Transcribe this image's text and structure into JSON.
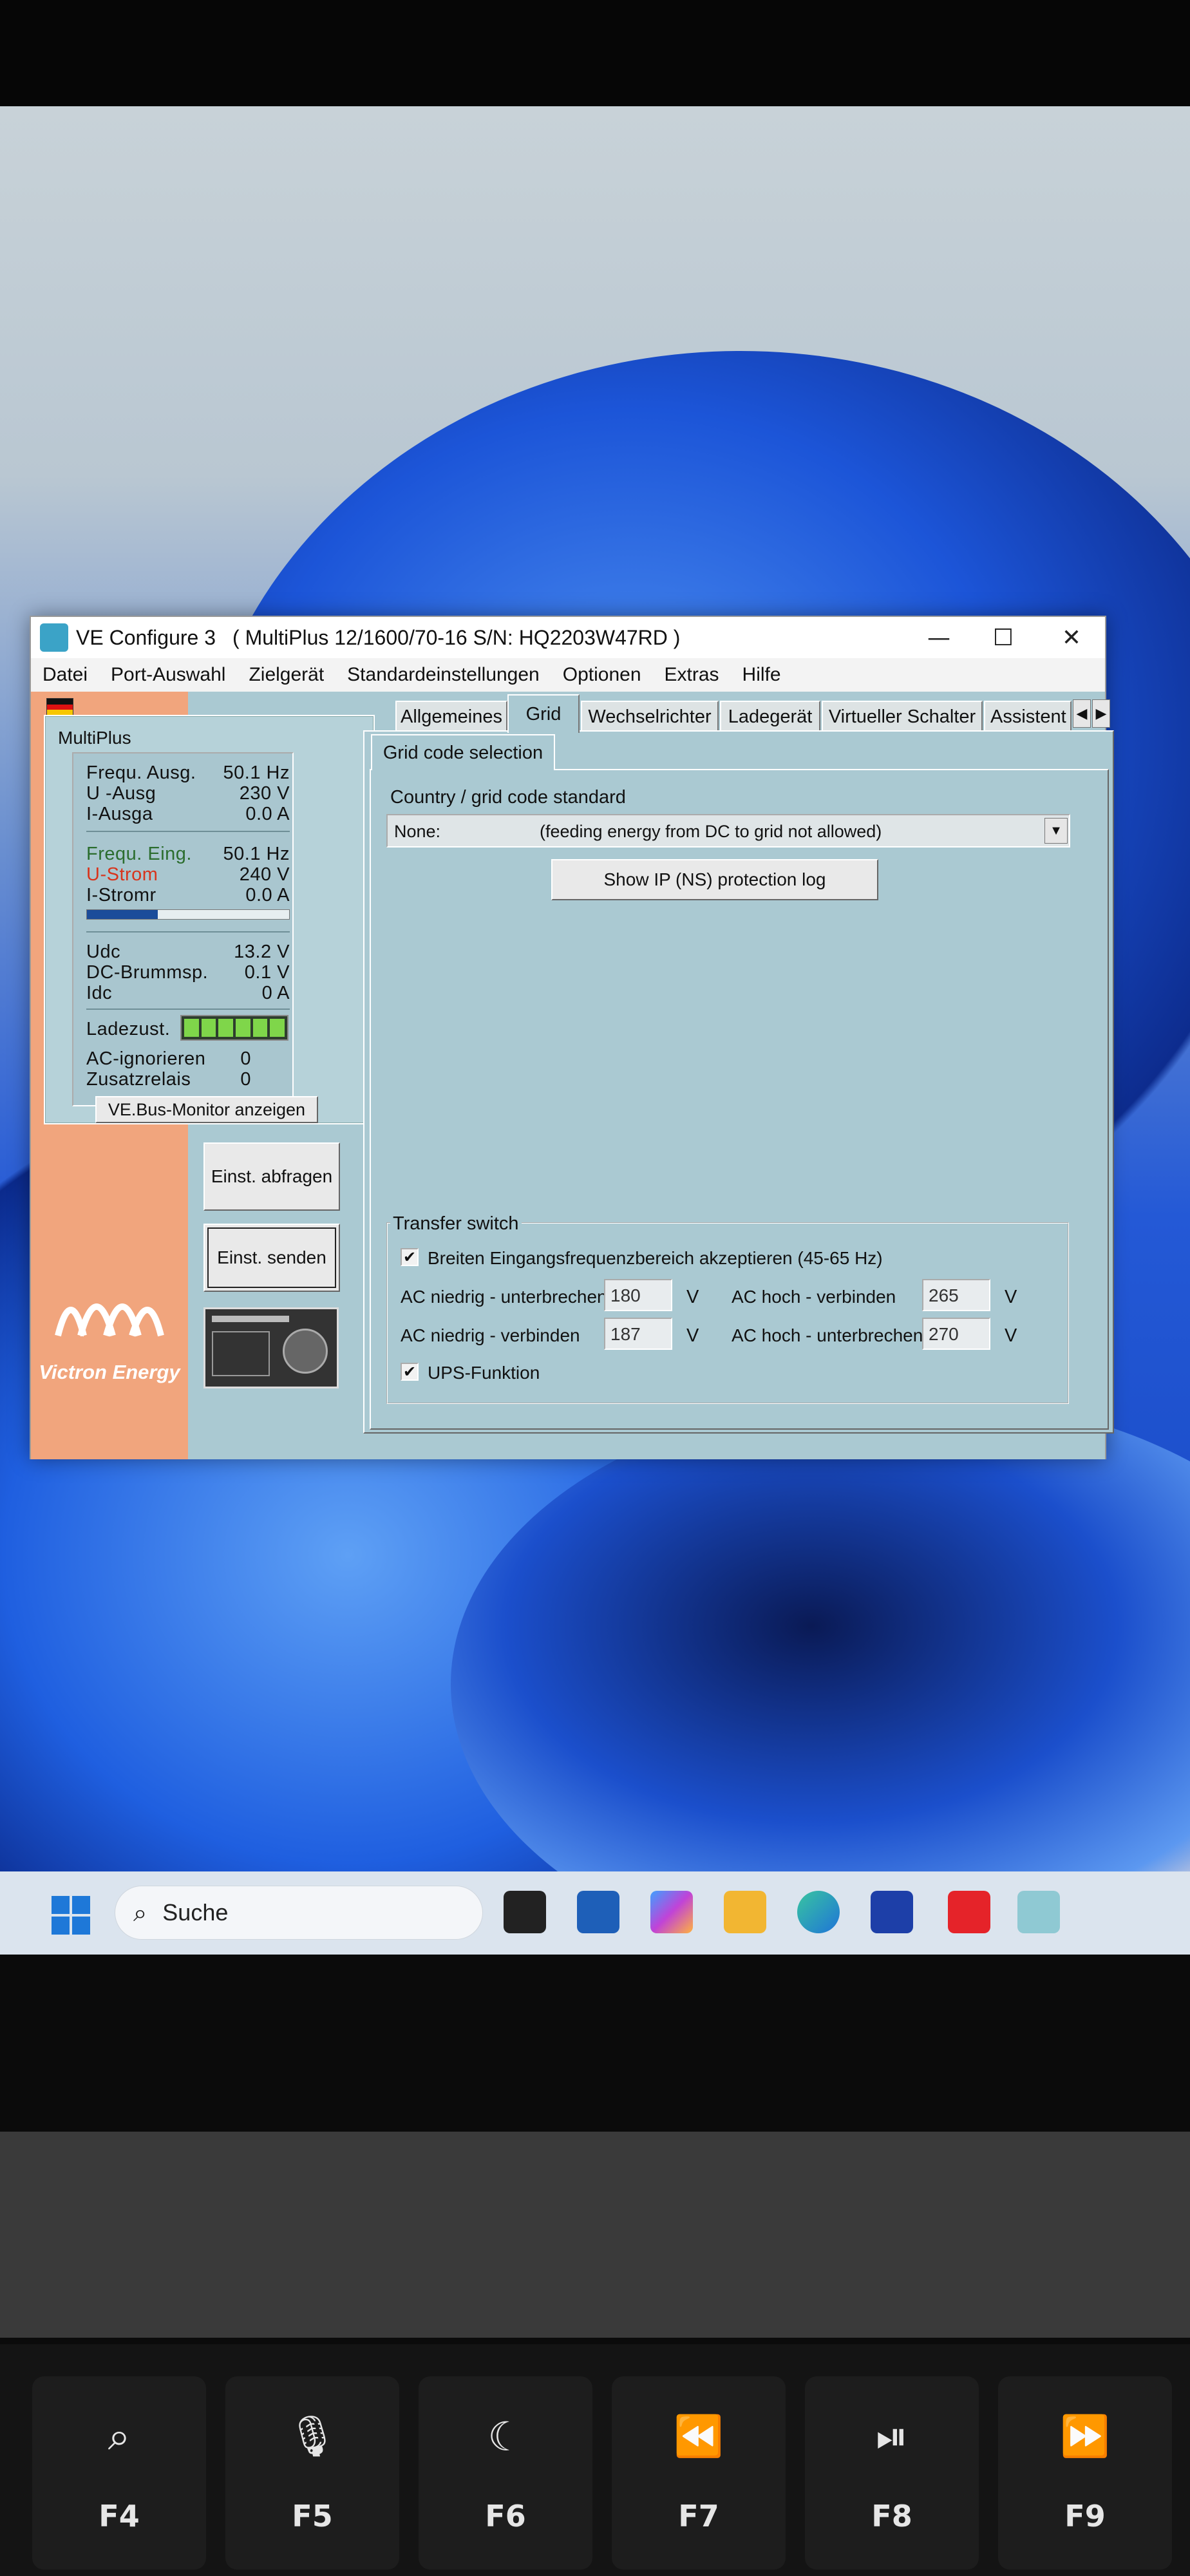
{
  "window": {
    "app_name": "VE Configure 3",
    "device_title": "( MultiPlus 12/1600/70-16 S/N: HQ2203W47RD )",
    "minimize": "—",
    "maximize": "☐",
    "close": "✕"
  },
  "menu": [
    "Datei",
    "Port-Auswahl",
    "Zielgerät",
    "Standardeinstellungen",
    "Optionen",
    "Extras",
    "Hilfe"
  ],
  "status_panel": {
    "title": "MultiPlus",
    "rows_out": [
      {
        "label": "Frequ. Ausg.",
        "value": "50.1 Hz"
      },
      {
        "label": "U -Ausg",
        "value": "230 V"
      },
      {
        "label": "I-Ausga",
        "value": "0.0 A"
      }
    ],
    "rows_in": [
      {
        "label": "Frequ. Eing.",
        "value": "50.1 Hz"
      },
      {
        "label": "U-Strom",
        "value": "240 V"
      },
      {
        "label": "I-Stromr",
        "value": "0.0 A"
      }
    ],
    "rows_dc": [
      {
        "label": "Udc",
        "value": "13.2 V"
      },
      {
        "label": "DC-Brummsp.",
        "value": "0.1 V"
      },
      {
        "label": "Idc",
        "value": "0 A"
      }
    ],
    "ladezust_label": "Ladezust.",
    "ac_ignore_label": "AC-ignorieren",
    "ac_ignore_value": "0",
    "relay_label": "Zusatzrelais",
    "relay_value": "0",
    "monitor_button": "VE.Bus-Monitor anzeigen",
    "input_current_fraction": 0.35
  },
  "side_buttons": {
    "query": "Einst. abfragen",
    "send": "Einst. senden"
  },
  "logo_text": "Victron Energy",
  "tabs": [
    "Allgemeines",
    "Grid",
    "Wechselrichter",
    "Ladegerät",
    "Virtueller Schalter",
    "Assistent"
  ],
  "active_tab": "Grid",
  "subtab": "Grid code selection",
  "grid": {
    "country_label": "Country / grid code standard",
    "selected_code": "None:",
    "selected_desc": "(feeding energy from DC to grid not allowed)",
    "show_log_button": "Show IP (NS) protection log"
  },
  "transfer": {
    "legend": "Transfer switch",
    "wide_freq_label": "Breiten Eingangsfrequenzbereich akzeptieren (45-65 Hz)",
    "low_disconnect_label": "AC niedrig - unterbrechen",
    "low_disconnect_value": "180",
    "low_connect_label": "AC niedrig - verbinden",
    "low_connect_value": "187",
    "high_connect_label": "AC hoch - verbinden",
    "high_connect_value": "265",
    "high_disconnect_label": "AC hoch - unterbrechen",
    "high_disconnect_value": "270",
    "unit": "V",
    "ups_label": "UPS-Funktion",
    "check": "✔"
  },
  "taskbar": {
    "search_placeholder": "Suche",
    "start_icon": "windows-start-icon"
  },
  "keys": [
    {
      "icon": "⌕",
      "label": "F4"
    },
    {
      "icon": "🎙",
      "label": "F5"
    },
    {
      "icon": "☾",
      "label": "F6"
    },
    {
      "icon": "⏪",
      "label": "F7"
    },
    {
      "icon": "⏯",
      "label": "F8"
    },
    {
      "icon": "⏩",
      "label": "F9"
    }
  ]
}
